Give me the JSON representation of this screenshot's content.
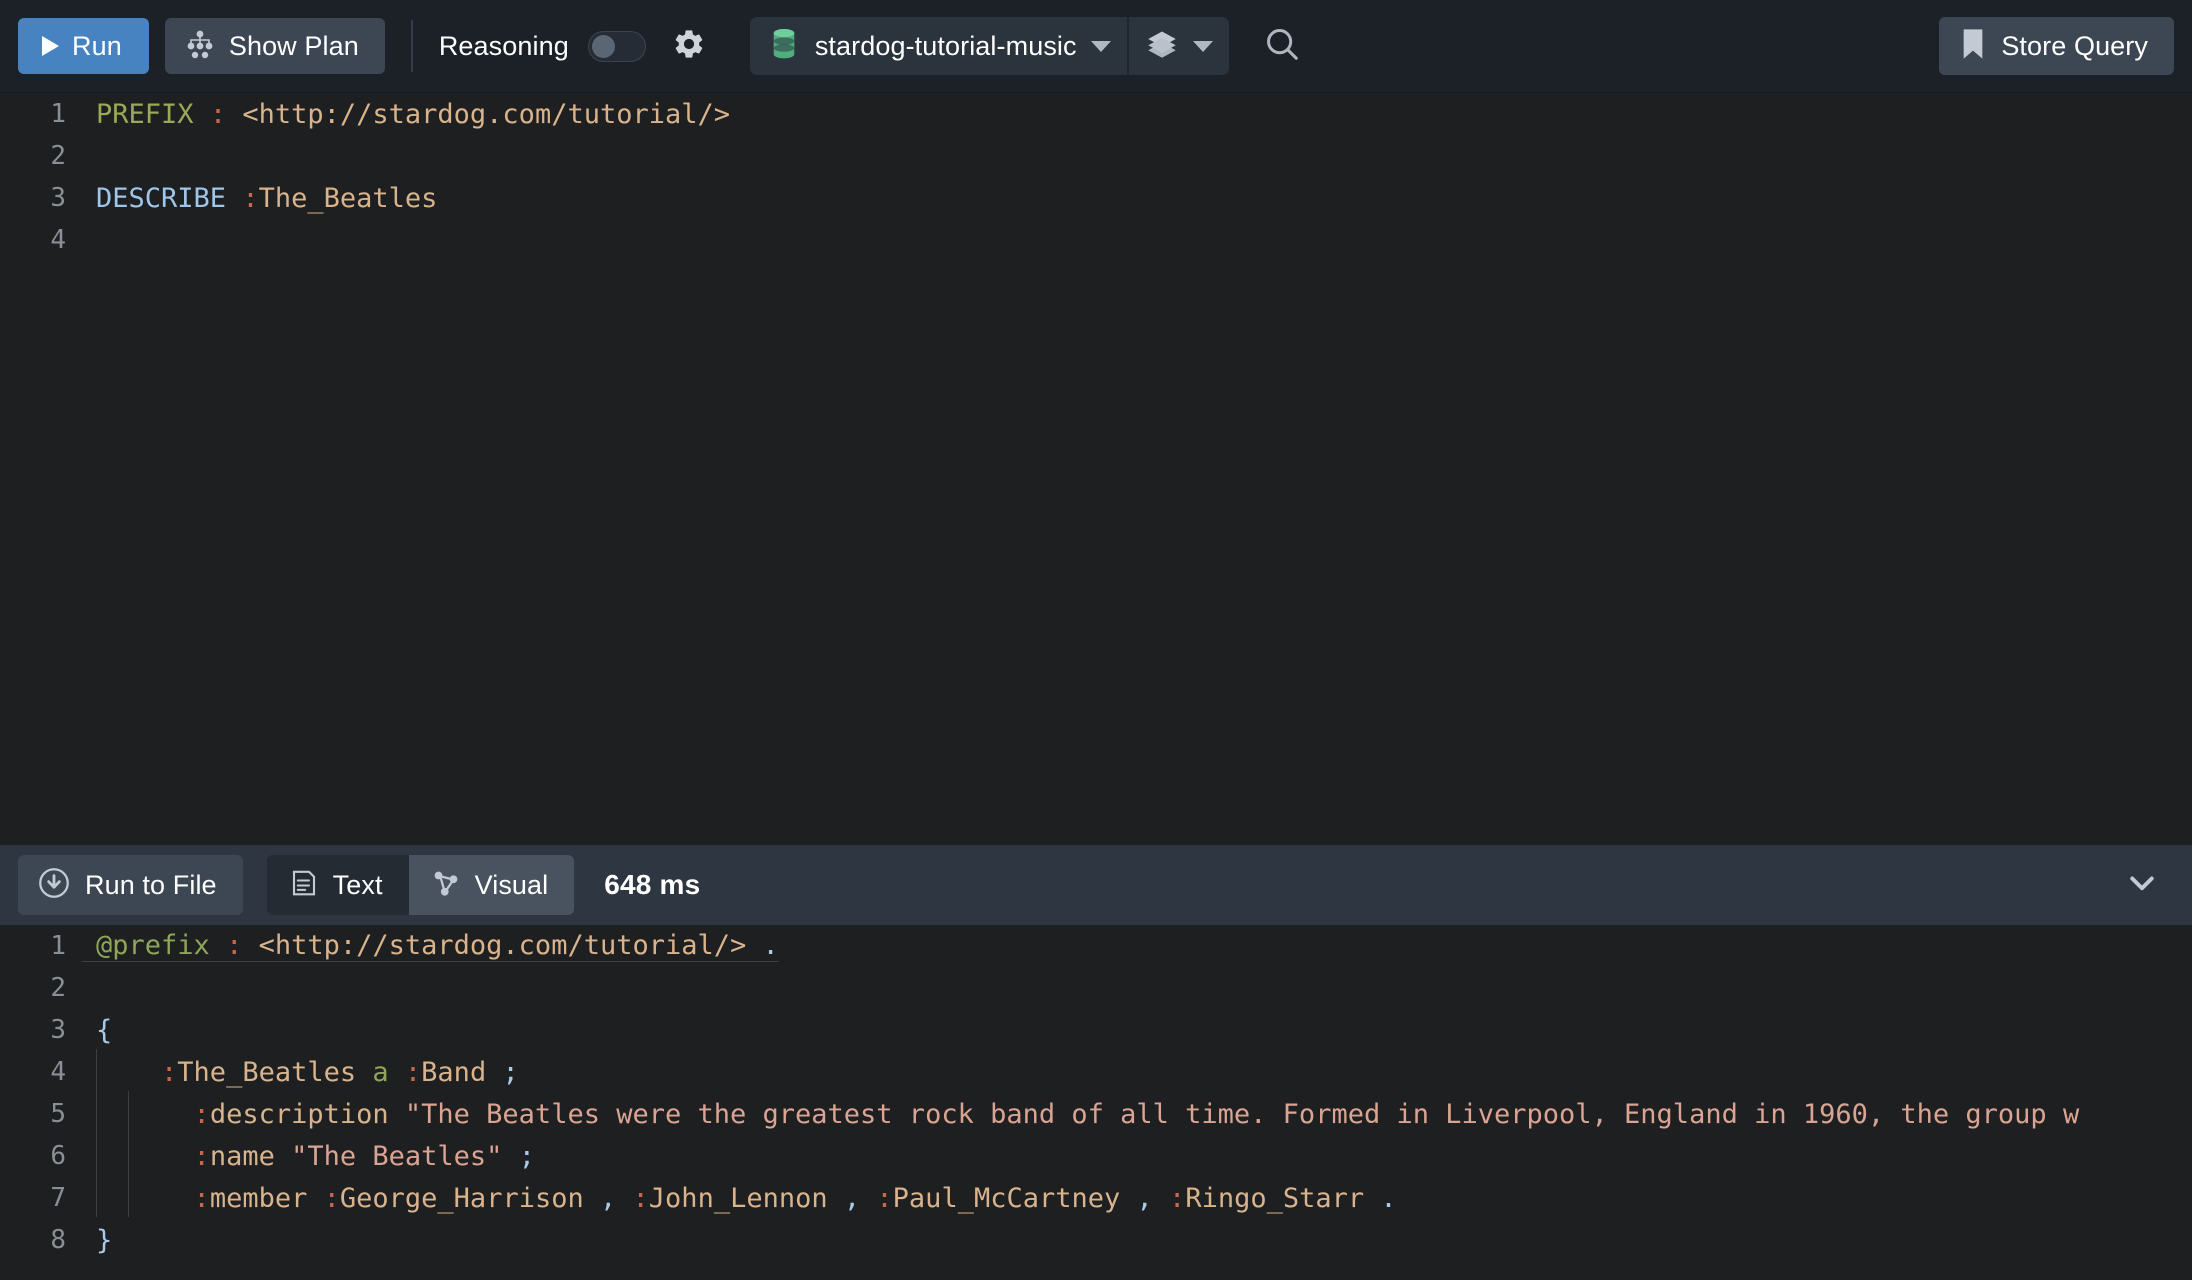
{
  "toolbar": {
    "run_label": "Run",
    "run_icon": "play-icon",
    "show_plan_label": "Show Plan",
    "show_plan_icon": "plan-tree-icon",
    "reasoning_label": "Reasoning",
    "reasoning_toggle_state": "off",
    "settings_icon": "gear-icon",
    "database_name": "stardog-tutorial-music",
    "database_icon": "database-icon",
    "database_caret_icon": "caret-down-icon",
    "layers_icon": "layers-icon",
    "layers_caret_icon": "caret-down-icon",
    "search_icon": "search-icon",
    "store_query_label": "Store Query",
    "store_query_icon": "bookmark-icon",
    "accent_color": "#4683c0",
    "button_color": "#3c4753",
    "db_icon_color": "#5cbd8a"
  },
  "editor": {
    "lines": [
      {
        "number": "1",
        "tokens": [
          {
            "text": "PREFIX",
            "cls": "k-prefix"
          },
          {
            "text": " ",
            "cls": "k-punct"
          },
          {
            "text": ":",
            "cls": "k-colon"
          },
          {
            "text": " ",
            "cls": "k-punct"
          },
          {
            "text": "<http://stardog.com/tutorial/>",
            "cls": "k-uri"
          }
        ]
      },
      {
        "number": "2",
        "tokens": []
      },
      {
        "number": "3",
        "tokens": [
          {
            "text": "DESCRIBE",
            "cls": "k-describe"
          },
          {
            "text": " ",
            "cls": "k-punct"
          },
          {
            "text": ":",
            "cls": "k-colon"
          },
          {
            "text": "The_Beatles",
            "cls": "k-name"
          }
        ]
      },
      {
        "number": "4",
        "tokens": []
      }
    ],
    "plain_query": "PREFIX : <http://stardog.com/tutorial/>\n\nDESCRIBE :The_Beatles\n"
  },
  "results": {
    "run_to_file_label": "Run to File",
    "run_to_file_icon": "download-circle-icon",
    "tab_text_label": "Text",
    "tab_text_icon": "document-icon",
    "tab_visual_label": "Visual",
    "tab_visual_icon": "graph-node-icon",
    "active_tab": "Visual",
    "timing": "648 ms",
    "collapse_icon": "chevron-down-icon",
    "lines": [
      {
        "number": "1",
        "indent": 0,
        "tokens": [
          {
            "text": "@prefix",
            "cls": "k-green"
          },
          {
            "text": " ",
            "cls": "k-punct"
          },
          {
            "text": ":",
            "cls": "k-colon"
          },
          {
            "text": " ",
            "cls": "k-punct"
          },
          {
            "text": "<http://stardog.com/tutorial/>",
            "cls": "k-uri"
          },
          {
            "text": " ",
            "cls": "k-punct"
          },
          {
            "text": ".",
            "cls": "k-brace"
          }
        ]
      },
      {
        "number": "2",
        "indent": 0,
        "tokens": []
      },
      {
        "number": "3",
        "indent": 0,
        "tokens": [
          {
            "text": "{",
            "cls": "k-brace"
          }
        ]
      },
      {
        "number": "4",
        "indent": 1,
        "tokens": [
          {
            "text": "    ",
            "cls": "k-punct"
          },
          {
            "text": ":",
            "cls": "k-colon"
          },
          {
            "text": "The_Beatles",
            "cls": "k-name"
          },
          {
            "text": " ",
            "cls": "k-punct"
          },
          {
            "text": "a",
            "cls": "k-green"
          },
          {
            "text": " ",
            "cls": "k-punct"
          },
          {
            "text": ":",
            "cls": "k-colon"
          },
          {
            "text": "Band",
            "cls": "k-name"
          },
          {
            "text": " ",
            "cls": "k-punct"
          },
          {
            "text": ";",
            "cls": "k-brace"
          }
        ]
      },
      {
        "number": "5",
        "indent": 2,
        "tokens": [
          {
            "text": "      ",
            "cls": "k-punct"
          },
          {
            "text": ":",
            "cls": "k-colon"
          },
          {
            "text": "description",
            "cls": "k-name"
          },
          {
            "text": " ",
            "cls": "k-punct"
          },
          {
            "text": "\"The Beatles were the greatest rock band of all time. Formed in Liverpool, England in 1960, the group w",
            "cls": "k-str"
          }
        ]
      },
      {
        "number": "6",
        "indent": 2,
        "tokens": [
          {
            "text": "      ",
            "cls": "k-punct"
          },
          {
            "text": ":",
            "cls": "k-colon"
          },
          {
            "text": "name",
            "cls": "k-name"
          },
          {
            "text": " ",
            "cls": "k-punct"
          },
          {
            "text": "\"The Beatles\"",
            "cls": "k-str"
          },
          {
            "text": " ",
            "cls": "k-punct"
          },
          {
            "text": ";",
            "cls": "k-brace"
          }
        ]
      },
      {
        "number": "7",
        "indent": 2,
        "tokens": [
          {
            "text": "      ",
            "cls": "k-punct"
          },
          {
            "text": ":",
            "cls": "k-colon"
          },
          {
            "text": "member",
            "cls": "k-name"
          },
          {
            "text": " ",
            "cls": "k-punct"
          },
          {
            "text": ":",
            "cls": "k-colon"
          },
          {
            "text": "George_Harrison",
            "cls": "k-name"
          },
          {
            "text": " ",
            "cls": "k-punct"
          },
          {
            "text": ",",
            "cls": "k-brace"
          },
          {
            "text": " ",
            "cls": "k-punct"
          },
          {
            "text": ":",
            "cls": "k-colon"
          },
          {
            "text": "John_Lennon",
            "cls": "k-name"
          },
          {
            "text": " ",
            "cls": "k-punct"
          },
          {
            "text": ",",
            "cls": "k-brace"
          },
          {
            "text": " ",
            "cls": "k-punct"
          },
          {
            "text": ":",
            "cls": "k-colon"
          },
          {
            "text": "Paul_McCartney",
            "cls": "k-name"
          },
          {
            "text": " ",
            "cls": "k-punct"
          },
          {
            "text": ",",
            "cls": "k-brace"
          },
          {
            "text": " ",
            "cls": "k-punct"
          },
          {
            "text": ":",
            "cls": "k-colon"
          },
          {
            "text": "Ringo_Starr",
            "cls": "k-name"
          },
          {
            "text": " ",
            "cls": "k-punct"
          },
          {
            "text": ".",
            "cls": "k-brace"
          }
        ]
      },
      {
        "number": "8",
        "indent": 0,
        "tokens": [
          {
            "text": "}",
            "cls": "k-brace"
          }
        ]
      }
    ]
  }
}
